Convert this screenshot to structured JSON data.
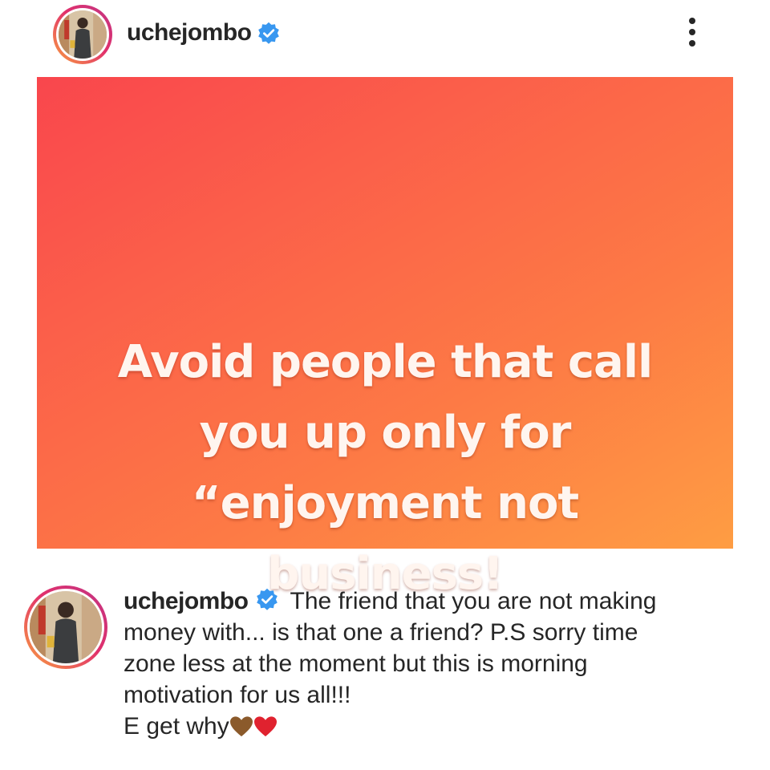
{
  "header": {
    "username": "uchejombo",
    "verified_icon": "verified-badge-icon",
    "more_icon": "more-options-icon"
  },
  "post": {
    "background_colors": [
      "#f9464d",
      "#fd7a45",
      "#fe9d43"
    ],
    "quote_lines": [
      "Avoid people that call",
      "you up only for",
      "“enjoyment not",
      "business!"
    ]
  },
  "caption": {
    "username": "uchejombo",
    "lines": [
      "The friend that you are not making",
      "money with... is that one a friend?  P.S sorry time",
      "zone less at the moment but this is morning",
      "motivation for us all!!!",
      "E get why"
    ],
    "emojis": [
      "brown-heart-icon",
      "red-heart-icon"
    ]
  },
  "colors": {
    "verified": "#3897f0",
    "text": "#262626",
    "brown_heart": "#8b5a2b",
    "red_heart": "#e0222f"
  }
}
